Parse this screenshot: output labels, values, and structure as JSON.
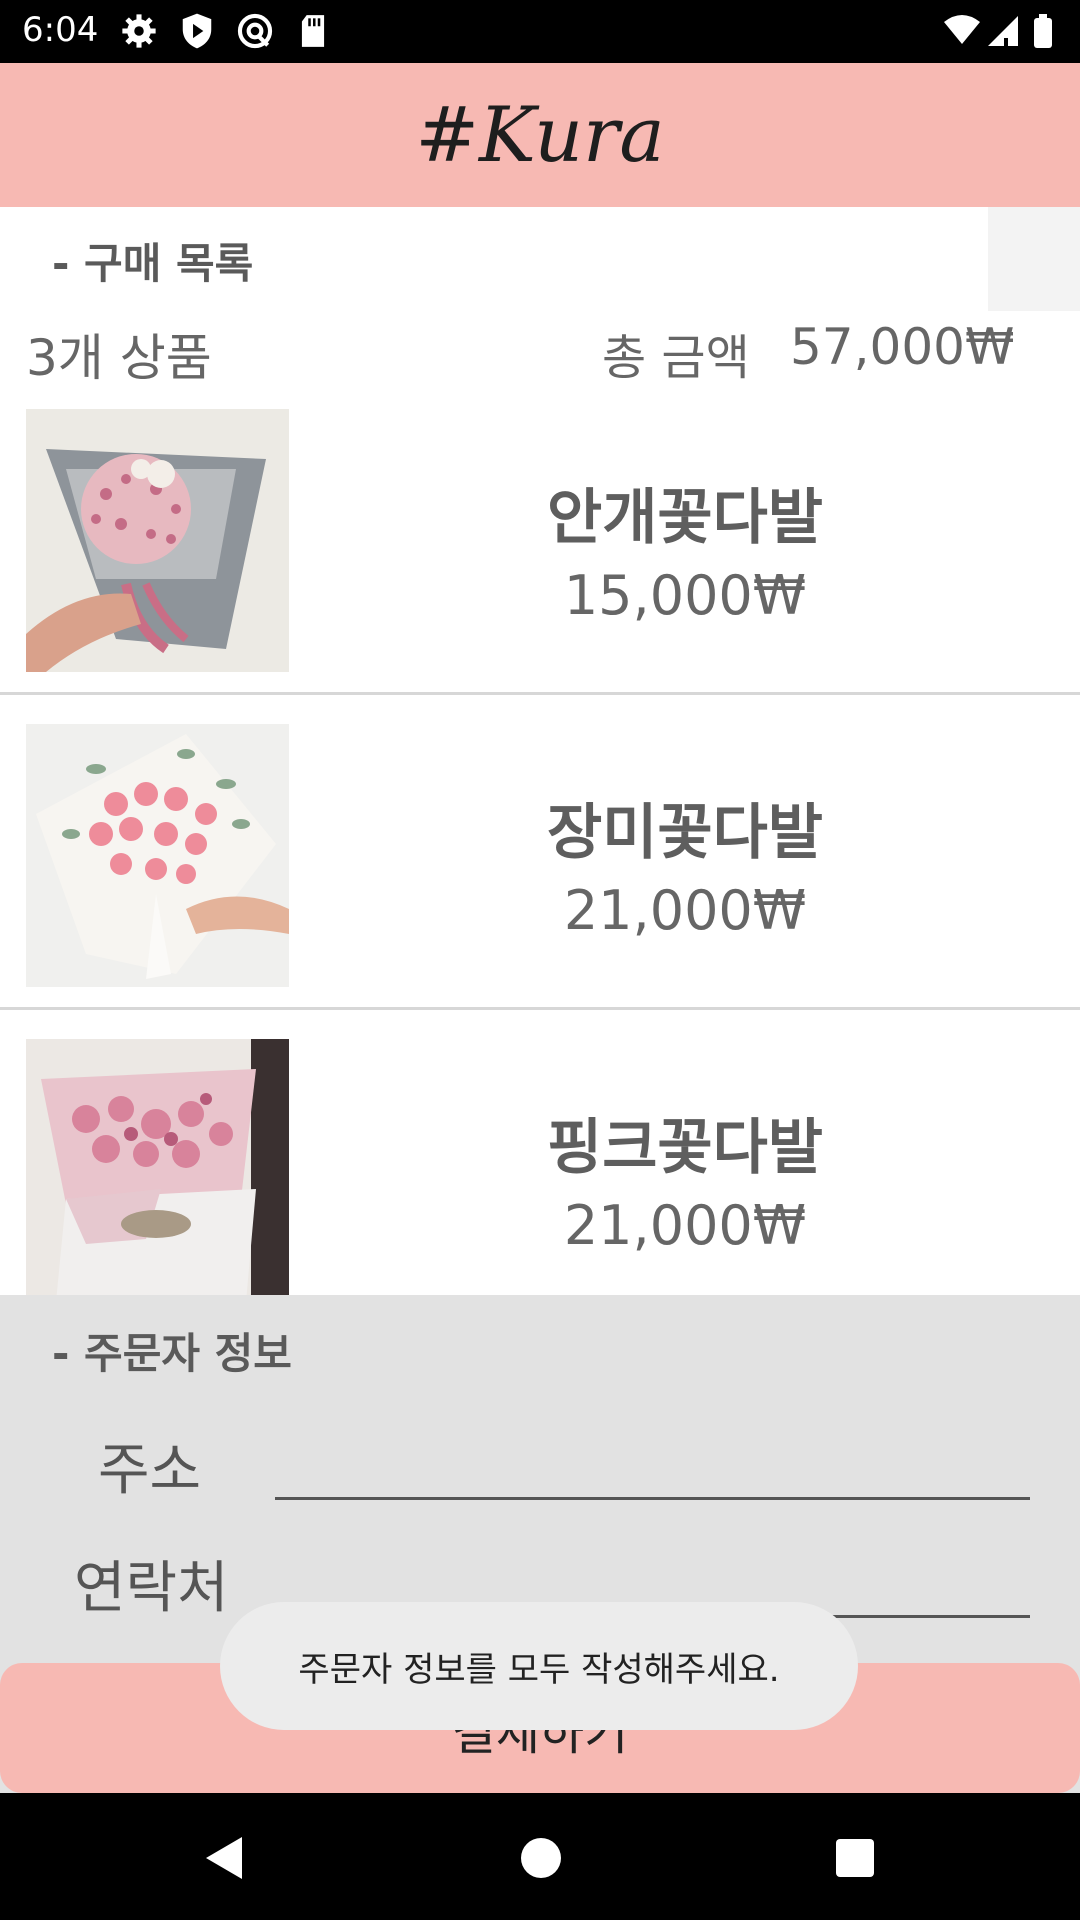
{
  "status_bar": {
    "time": "6:04",
    "left_icons": [
      "gear-icon",
      "shield-play-icon",
      "at-sign-icon",
      "sd-card-icon"
    ],
    "right_icons": [
      "wifi-icon",
      "signal-icon",
      "battery-icon"
    ]
  },
  "app_bar": {
    "title": "#Kura"
  },
  "purchase": {
    "section_title": "- 구매 목록",
    "count_text": "3개 상품",
    "total_label": "총 금액",
    "total_value": "57,000₩",
    "items": [
      {
        "name": "안개꽃다발",
        "price": "15,000₩"
      },
      {
        "name": "장미꽃다발",
        "price": "21,000₩"
      },
      {
        "name": "핑크꽃다발",
        "price": "21,000₩"
      }
    ]
  },
  "orderer": {
    "section_title": "- 주문자 정보",
    "address_label": "주소",
    "address_value": "",
    "contact_label": "연락처",
    "contact_value": ""
  },
  "pay_button_label": "결제하기",
  "toast_message": "주문자 정보를 모두 작성해주세요.",
  "colors": {
    "accent_pink": "#f7b9b3",
    "panel_gray": "#e2e2e2"
  },
  "nav_bar": {
    "icons": [
      "back-icon",
      "home-icon",
      "recents-icon"
    ]
  }
}
